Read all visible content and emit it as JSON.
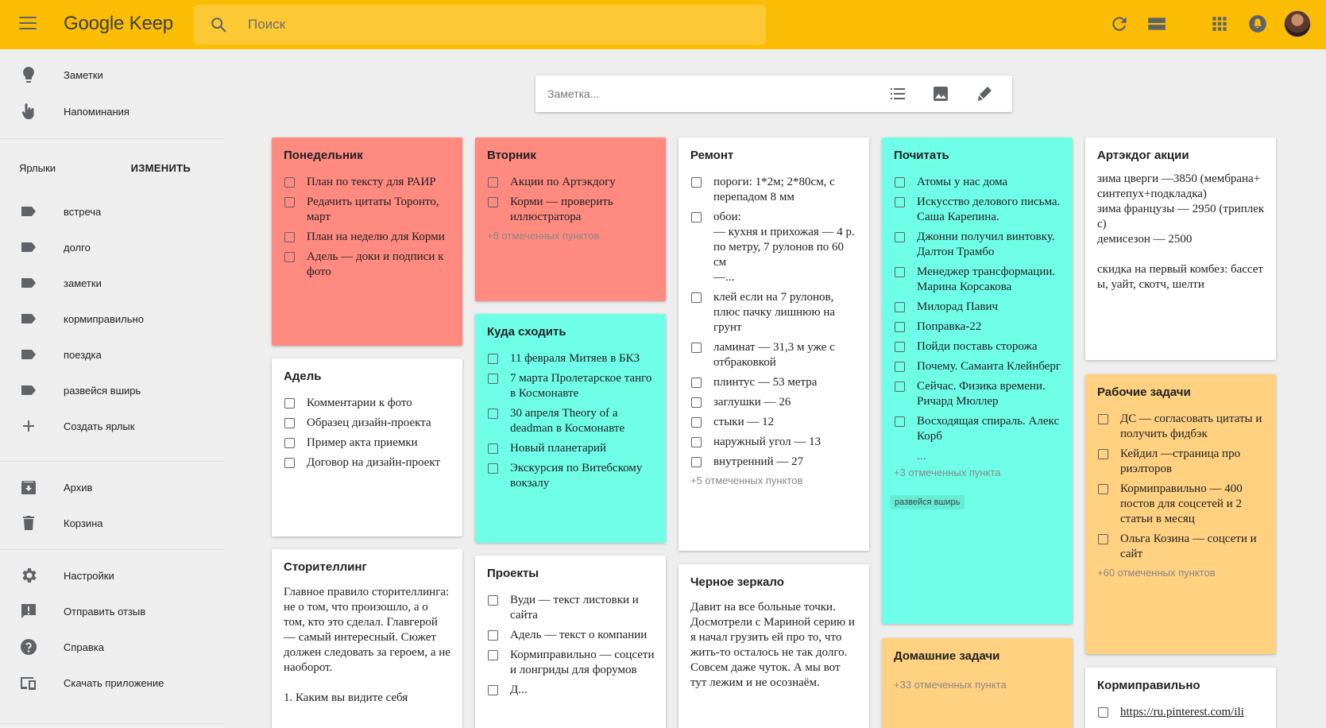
{
  "header": {
    "logo_google": "Google",
    "logo_keep": "Keep",
    "search_placeholder": "Поиск"
  },
  "sidebar": {
    "top_items": [
      {
        "label": "Заметки",
        "icon": "lightbulb-icon"
      },
      {
        "label": "Напоминания",
        "icon": "reminder-hand-icon"
      }
    ],
    "labels_title": "Ярлыки",
    "labels_edit": "ИЗМЕНИТЬ",
    "labels": [
      "встреча",
      "долго",
      "заметки",
      "кормиправильно",
      "поездка",
      "развейся вширь"
    ],
    "create_label": "Создать ярлык",
    "archive": "Архив",
    "trash": "Корзина",
    "settings": "Настройки",
    "feedback": "Отправить отзыв",
    "help": "Справка",
    "download": "Скачать приложение"
  },
  "take_note": {
    "placeholder": "Заметка..."
  },
  "colors": {
    "header": "#fbbc04",
    "red": "#ff8a80",
    "teal": "#6fffe9",
    "orange": "#ffd180",
    "white": "#ffffff"
  },
  "notes": {
    "monday": {
      "title": "Понедельник",
      "items": [
        "План по тексту для РАИР",
        "Редачить цитаты Торонто, март",
        "План на неделю для Корми",
        "Адель — доки и подписи к фото"
      ]
    },
    "adel": {
      "title": "Адель",
      "items": [
        "Комментарии к фото",
        "Образец дизайн-проекта",
        "Пример акта приемки",
        "Договор на дизайн-проект"
      ]
    },
    "story": {
      "title": "Сторителлинг",
      "text": "Главное правило сторителлинга: не о том, что произошло, а о том, кто это сделал. Главгерой — самый интересный. Сюжет должен следовать за героем, а не наоборот.\n\n1. Каким вы видите себя"
    },
    "tuesday": {
      "title": "Вторник",
      "items": [
        "Акции по Артэкдогу",
        "Корми — проверить иллюстратора"
      ],
      "checked_more": "+8 отмеченных пунктов"
    },
    "where": {
      "title": "Куда сходить",
      "items": [
        "11 февраля Митяев в БКЗ",
        "7 марта Пролетарское танго в Космонавте",
        "30 апреля Theory of a deadman в Космонавте",
        "Новый планетарий",
        "Экскурсия по Витебскому вокзалу"
      ]
    },
    "projects": {
      "title": "Проекты",
      "items": [
        "Вуди — текст листовки и сайта",
        "Адель — текст о компании",
        "Кормиправильно — соцсети и лонгриды для форумов",
        "Д..."
      ]
    },
    "repair": {
      "title": "Ремонт",
      "items": [
        "пороги: 1*2м; 2*80см, с перепадом 8 мм",
        "обои:\n— кухня и прихожая — 4 р. по метру,  7 рулонов по 60 см\n—...",
        "клей если на 7 рулонов, плюс пачку лишнюю на грунт",
        "ламинат — 31,3 м уже с отбраковкой",
        "плинтус — 53 метра",
        "заглушки — 26",
        "стыки — 12",
        "наружный угол — 13",
        "внутренний — 27"
      ],
      "checked_more": "+5 отмеченных пунктов"
    },
    "mirror": {
      "title": "Черное зеркало",
      "text": "Давит на все больные точки. Досмотрели с Мариной серию и я начал грузить ей про то, что жить-то осталось не так долго. Совсем даже чуток. А мы вот тут лежим и не осознаём."
    },
    "read": {
      "title": "Почитать",
      "items": [
        "Атомы у нас дома",
        "Искусство делового письма. Саша Карепина.",
        "Джонни получил винтовку. Далтон Трамбо",
        "Менеджер трансформации. Марина Корсакова",
        "Милорад Павич",
        "Поправка-22",
        "Пойди поставь сторожа",
        "Почему. Саманта Клейнберг",
        "Сейчас. Физика времени. Ричард Мюллер",
        "Восходящая спираль. Алекс Корб"
      ],
      "ellipsis": "...",
      "checked_more": "+3 отмеченных пункта",
      "chip": "развейся вширь"
    },
    "home": {
      "title": "Домашние задачи",
      "checked_more": "+33 отмеченных пункта"
    },
    "artdog": {
      "title": "Артэкдог акции",
      "text": "зима цверги —3850 (мембрана+синтепух+подкладка)\nзима французы — 2950 (триплекс)\nдемисезон — 2500\n\nскидка на первый комбез: бассеты, уайт, скотч, шелти"
    },
    "work": {
      "title": "Рабочие задачи",
      "items": [
        "ДС — согласовать цитаты и получить фидбэк",
        "Кейдил —страница про риэлторов",
        "Кормиправильно — 400 постов для соцсетей и 2 статьи в месяц",
        "Ольга Козина — соцсети и сайт"
      ],
      "checked_more": "+60 отмеченных пунктов"
    },
    "korm": {
      "title": "Кормиправильно",
      "link": "https://ru.pinterest.com/ili"
    }
  }
}
